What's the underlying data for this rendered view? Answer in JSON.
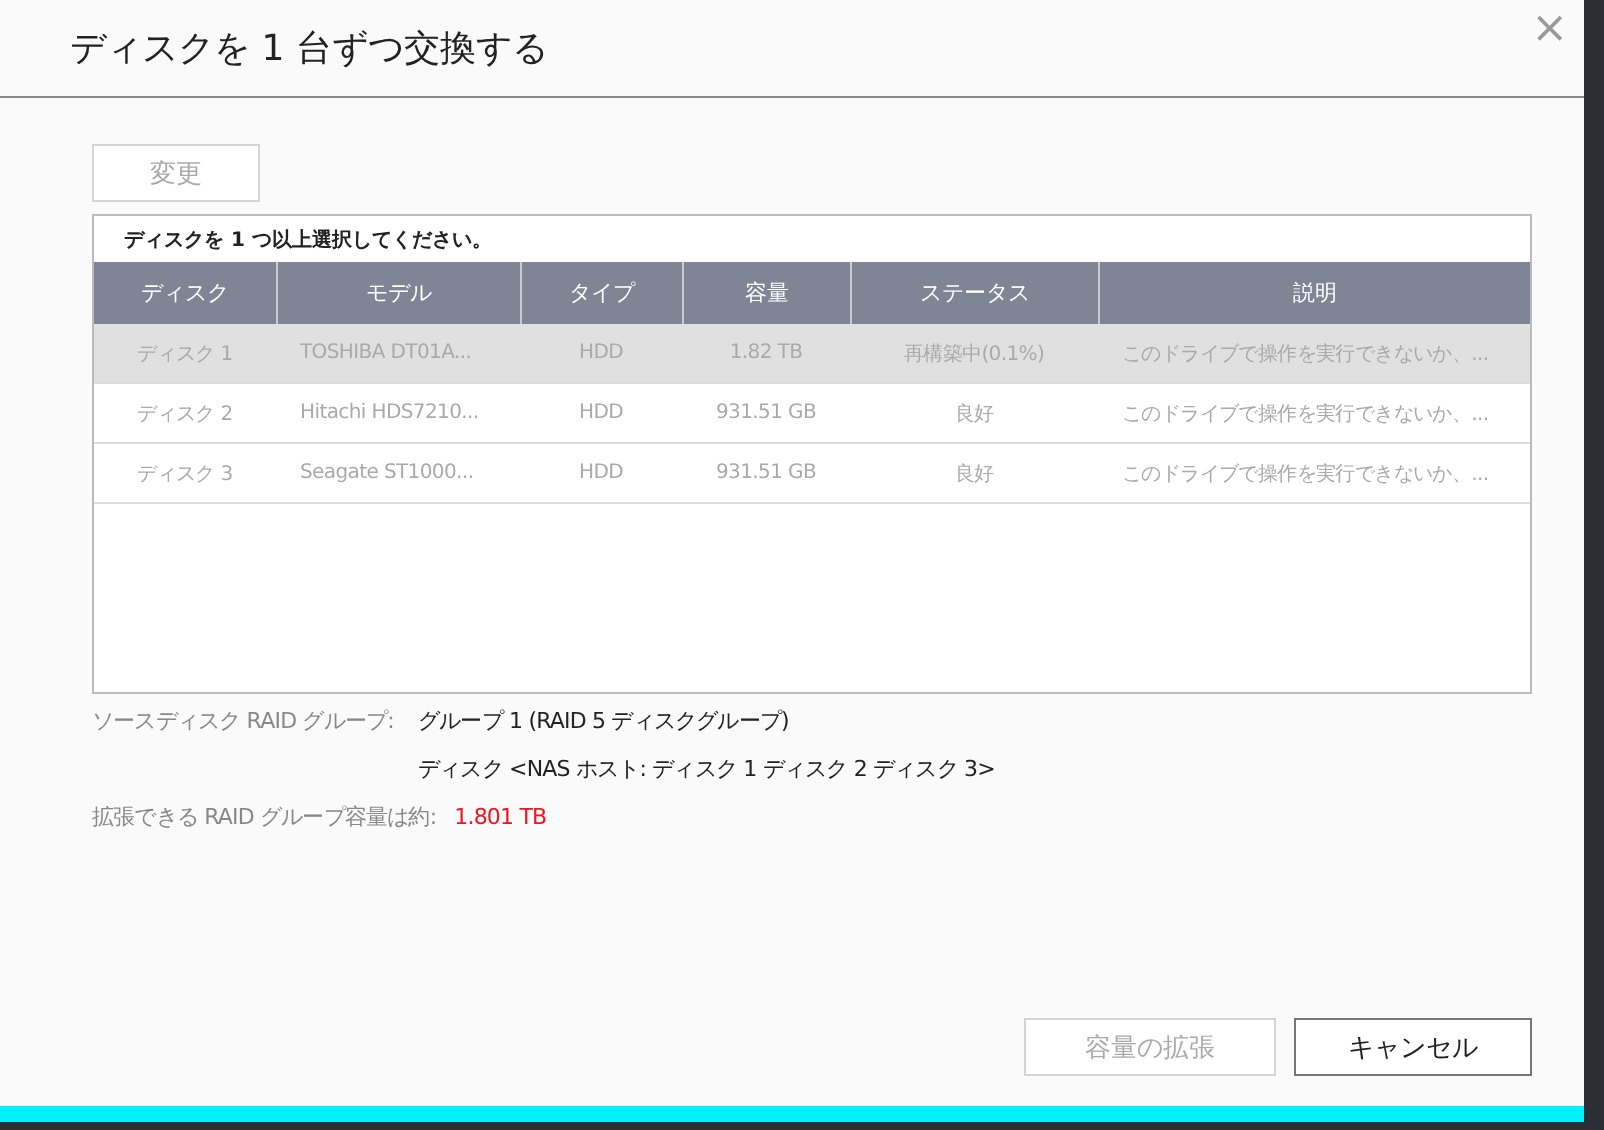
{
  "dialog": {
    "title": "ディスクを 1 台ずつ交換する",
    "close": "×"
  },
  "change_button": {
    "label": "変更",
    "disabled": true
  },
  "table": {
    "notice": "ディスクを 1 つ以上選択してください。",
    "columns": [
      "ディスク",
      "モデル",
      "タイプ",
      "容量",
      "ステータス",
      "説明"
    ],
    "rows": [
      {
        "selected": true,
        "cells": [
          "ディスク 1",
          "TOSHIBA DT01A...",
          "HDD",
          "1.82 TB",
          "再構築中(0.1%)",
          "このドライブで操作を実行できないか、..."
        ]
      },
      {
        "selected": false,
        "cells": [
          "ディスク 2",
          "Hitachi HDS7210...",
          "HDD",
          "931.51 GB",
          "良好",
          "このドライブで操作を実行できないか、..."
        ]
      },
      {
        "selected": false,
        "cells": [
          "ディスク 3",
          "Seagate ST1000...",
          "HDD",
          "931.51 GB",
          "良好",
          "このドライブで操作を実行できないか、..."
        ]
      }
    ]
  },
  "info": [
    {
      "label": "ソースディスク RAID グループ:",
      "value": "グループ 1 (RAID 5 ディスクグループ)",
      "kind": "plain"
    },
    {
      "value": "ディスク <NAS ホスト: ディスク 1 ディスク 2 ディスク 3>",
      "kind": "plain"
    },
    {
      "label": "拡張できる RAID グループ容量は約:",
      "value": "1.801 TB",
      "kind": "highlight"
    }
  ],
  "buttons": [
    {
      "label": "容量の拡張",
      "disabled": true
    },
    {
      "label": "キャンセル",
      "disabled": false
    }
  ]
}
